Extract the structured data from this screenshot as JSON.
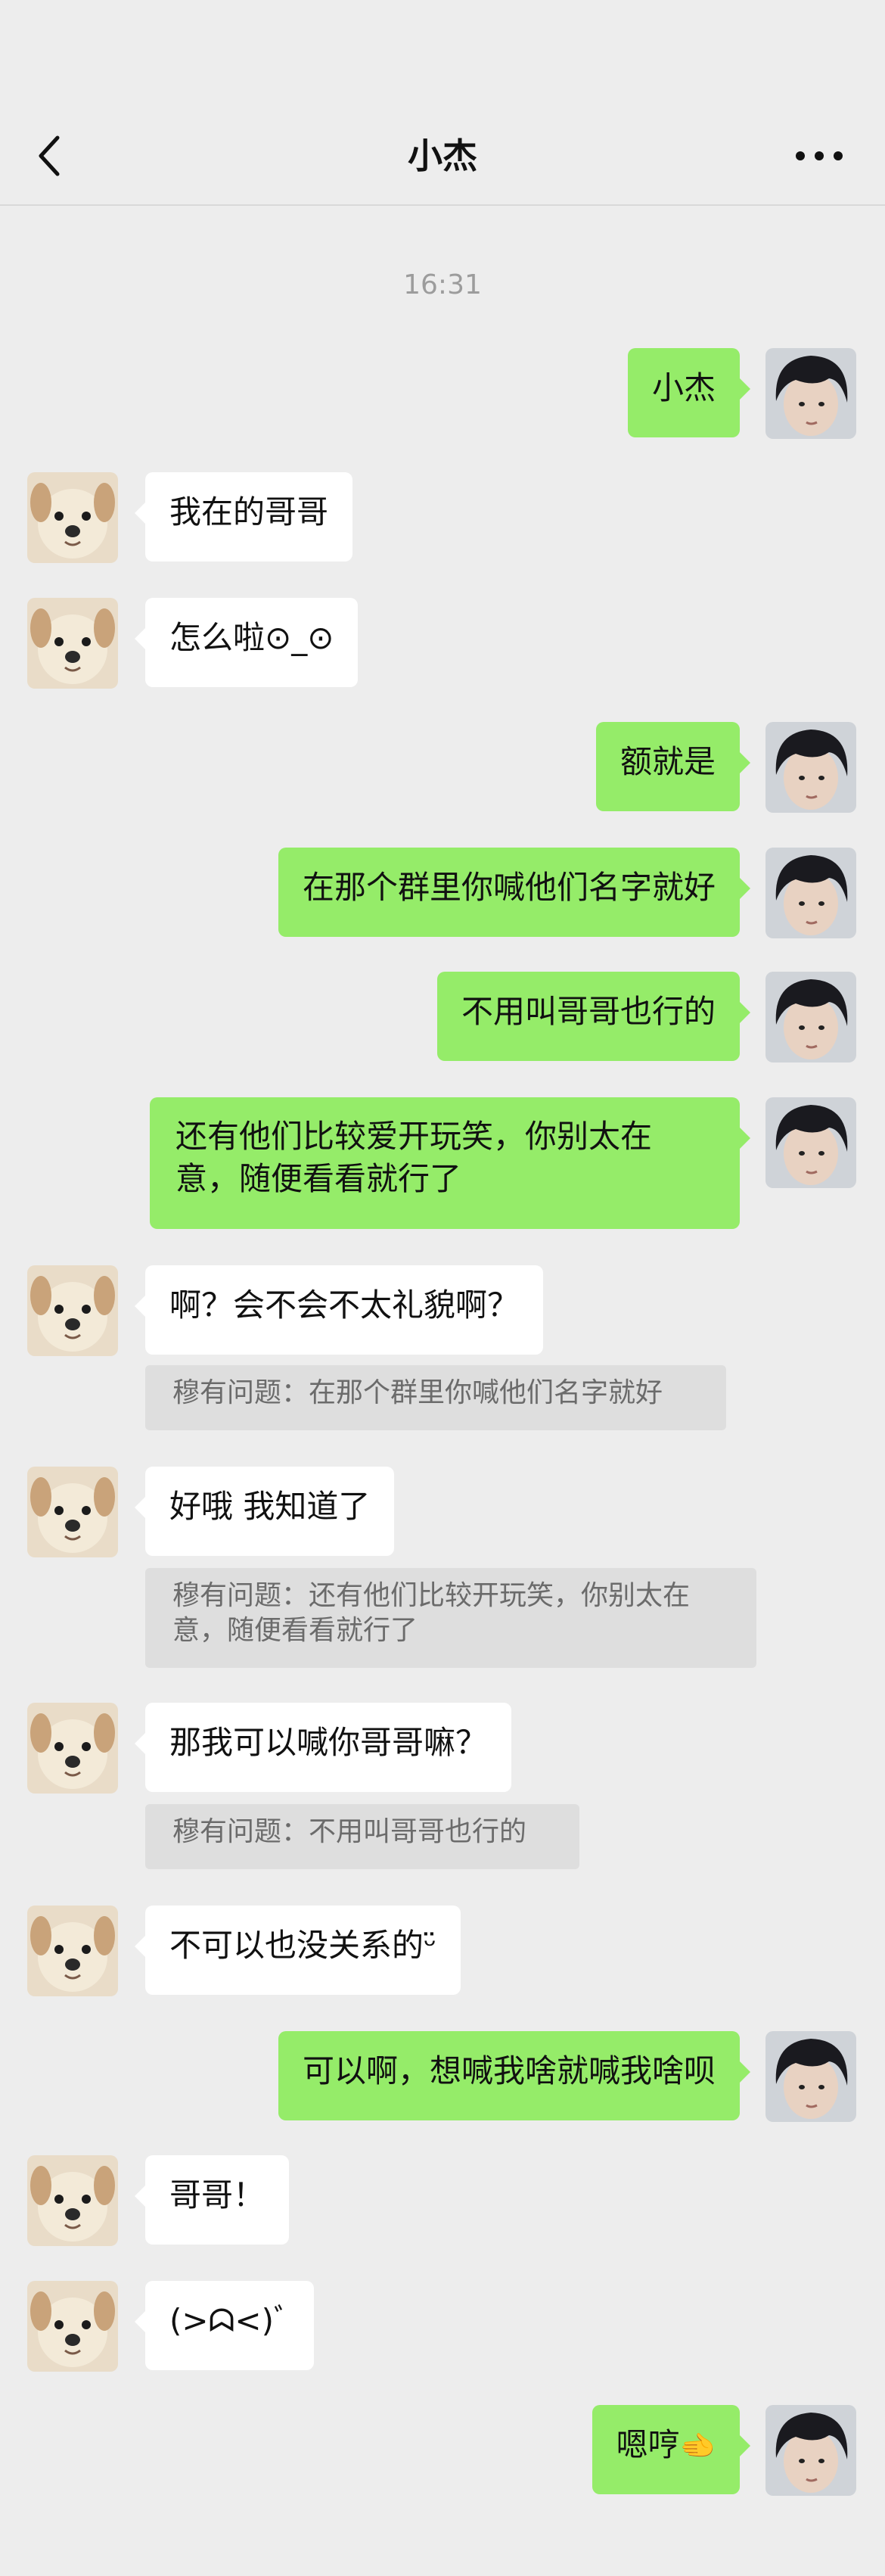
{
  "header": {
    "title": "小杰"
  },
  "timestamp": "16:31",
  "messages": [
    {
      "text": "小杰"
    },
    {
      "text": "我在的哥哥"
    },
    {
      "text": "怎么啦⊙_⊙"
    },
    {
      "text": "额就是"
    },
    {
      "text": "在那个群里你喊他们名字就好"
    },
    {
      "text": "不用叫哥哥也行的"
    },
    {
      "text": "还有他们比较爱开玩笑，你别太在意，随便看看就行了"
    },
    {
      "text": "啊？会不会不太礼貌啊？",
      "quote": "穆有问题：在那个群里你喊他们名字就好"
    },
    {
      "text": "好哦 我知道了",
      "quote": "穆有问题：还有他们比较开玩笑，你别太在意，随便看看就行了"
    },
    {
      "text": "那我可以喊你哥哥嘛？",
      "quote": "穆有问题：不用叫哥哥也行的"
    },
    {
      "text": "不可以也没关系的ᵕ̈"
    },
    {
      "text": "可以啊，想喊我啥就喊我啥呗"
    },
    {
      "text": "哥哥！"
    },
    {
      "text": "(>ᗣ<)ﾞ"
    },
    {
      "text": "嗯哼",
      "emoji": "🫲"
    }
  ]
}
